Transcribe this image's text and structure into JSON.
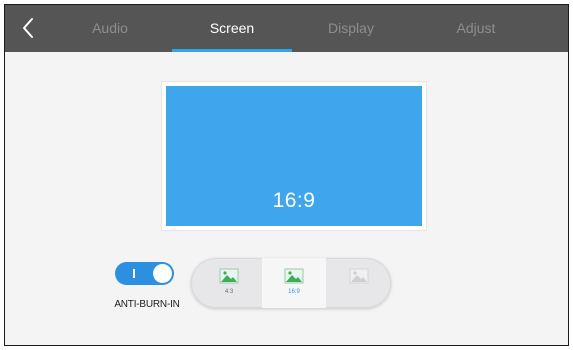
{
  "tabs": [
    {
      "label": "Audio",
      "active": false
    },
    {
      "label": "Screen",
      "active": true
    },
    {
      "label": "Display",
      "active": false
    },
    {
      "label": "Adjust",
      "active": false
    }
  ],
  "back_icon": "chevron-left-icon",
  "preview": {
    "ratio_label": "16:9",
    "color": "#3fa6ee"
  },
  "anti_burn_in": {
    "label": "ANTI-BURN-IN",
    "enabled": true,
    "color": "#2d8fe0"
  },
  "aspect_options": [
    {
      "label": "4:3",
      "icon": "image-icon",
      "selected": false,
      "enabled": true
    },
    {
      "label": "16:9",
      "icon": "image-icon",
      "selected": true,
      "enabled": true
    },
    {
      "label": "",
      "icon": "image-icon",
      "selected": false,
      "enabled": false
    }
  ],
  "colors": {
    "topbar": "#555555",
    "accent": "#33a4ec"
  }
}
